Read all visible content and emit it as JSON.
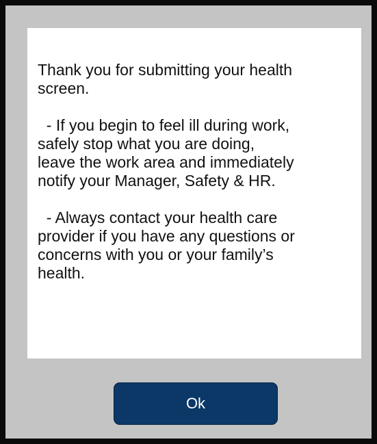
{
  "dialog": {
    "message": {
      "intro": "Thank you for submitting your health\nscreen.",
      "point_1": "  - If you begin to feel ill during work,\nsafely stop what you are doing,\nleave the work area and immediately\nnotify your Manager, Safety & HR.",
      "point_2": "  - Always contact your health care\nprovider if you have any questions or\nconcerns with you or your family’s\nhealth."
    },
    "ok_label": "Ok"
  },
  "colors": {
    "frame_border": "#0a0a0a",
    "frame_background": "#c4c4c4",
    "panel_background": "#ffffff",
    "button_background": "#0b3866",
    "button_text": "#ffffff"
  }
}
